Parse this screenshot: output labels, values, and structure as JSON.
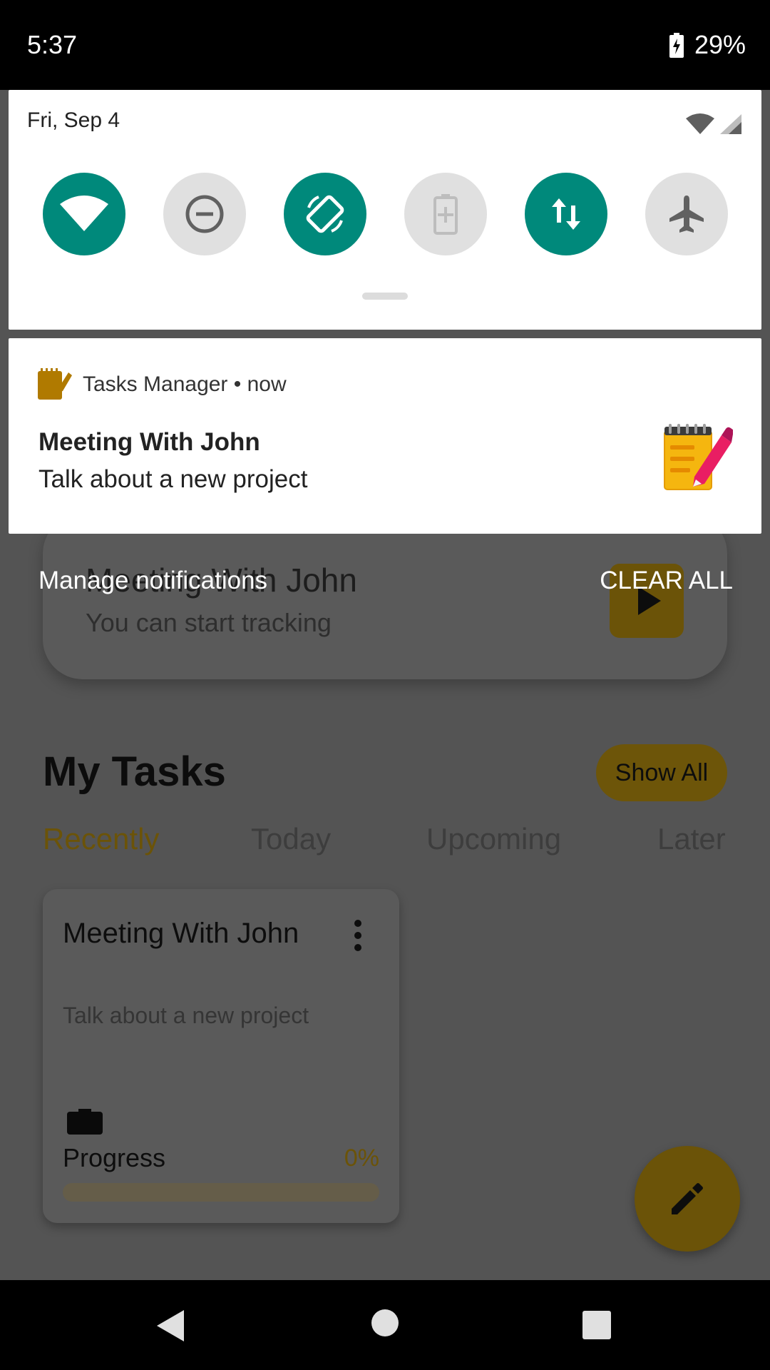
{
  "status_bar": {
    "time": "5:37",
    "battery": "29%",
    "battery_icon": "battery-charging-icon"
  },
  "quick_settings": {
    "date": "Fri, Sep 4",
    "tiles": [
      {
        "name": "wifi",
        "state": "on",
        "icon": "wifi-icon"
      },
      {
        "name": "do-not-disturb",
        "state": "off",
        "icon": "do-not-disturb-icon"
      },
      {
        "name": "auto-rotate",
        "state": "on",
        "icon": "auto-rotate-icon"
      },
      {
        "name": "battery-saver",
        "state": "off",
        "icon": "battery-saver-icon"
      },
      {
        "name": "mobile-data",
        "state": "on",
        "icon": "mobile-data-icon"
      },
      {
        "name": "airplane-mode",
        "state": "off",
        "icon": "airplane-icon"
      }
    ],
    "active_color": "#00897b",
    "inactive_color": "#e0e0e0"
  },
  "notification": {
    "app_name": "Tasks Manager",
    "separator": "•",
    "time": "now",
    "app_label": "Tasks Manager • now",
    "title": "Meeting With John",
    "text": "Talk about a new project"
  },
  "actions": {
    "manage": "Manage notifications",
    "clear_all": "CLEAR ALL"
  },
  "app": {
    "current_task": {
      "title": "Meeting With John",
      "subtitle": "You can start tracking"
    },
    "section_title": "My Tasks",
    "show_all": "Show All",
    "tabs": [
      "Recently",
      "Today",
      "Upcoming",
      "Later"
    ],
    "active_tab": "Recently",
    "task": {
      "title": "Meeting With John",
      "description": "Talk about a new project",
      "progress_label": "Progress",
      "progress_value": "0%",
      "progress_fraction": 0
    },
    "accent_color": "#f5b60f"
  }
}
